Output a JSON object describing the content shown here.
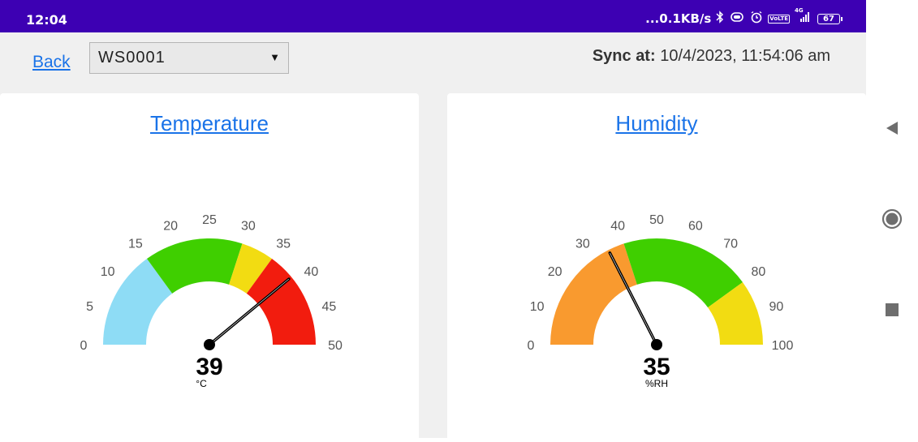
{
  "status_bar": {
    "time": "12:04",
    "network_speed": "...0.1KB/s",
    "net_badge": "VoLTE",
    "net_type": "4G",
    "battery": "67"
  },
  "header": {
    "back_label": "Back",
    "station": "WS0001",
    "sync_label": "Sync at:",
    "sync_time": "10/4/2023, 11:54:06 am"
  },
  "gauges": [
    {
      "id": "temperature",
      "title": "Temperature",
      "min": 0,
      "max": 50,
      "ticks": [
        "0",
        "5",
        "10",
        "15",
        "20",
        "25",
        "30",
        "35",
        "40",
        "45",
        "50"
      ],
      "value": 39,
      "value_text": "39",
      "unit": "°C",
      "bands": [
        {
          "from": 0,
          "to": 15,
          "color": "#8edcf5"
        },
        {
          "from": 15,
          "to": 30,
          "color": "#3fcf00"
        },
        {
          "from": 30,
          "to": 35,
          "color": "#f2dc12"
        },
        {
          "from": 35,
          "to": 50,
          "color": "#f21c0e"
        }
      ]
    },
    {
      "id": "humidity",
      "title": "Humidity",
      "min": 0,
      "max": 100,
      "ticks": [
        "0",
        "10",
        "20",
        "30",
        "40",
        "50",
        "60",
        "70",
        "80",
        "90",
        "100"
      ],
      "value": 35,
      "value_text": "35",
      "unit": "%RH",
      "bands": [
        {
          "from": 0,
          "to": 40,
          "color": "#f99a2f"
        },
        {
          "from": 40,
          "to": 80,
          "color": "#3fcf00"
        },
        {
          "from": 80,
          "to": 100,
          "color": "#f2dc12"
        }
      ]
    }
  ],
  "nav": {
    "back_icon": "triangle-left",
    "home_icon": "circle",
    "recents_icon": "square"
  }
}
